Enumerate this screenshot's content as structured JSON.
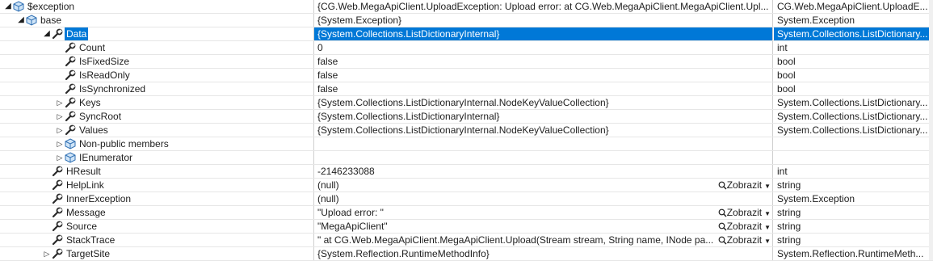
{
  "rows": [
    {
      "name": "$exception",
      "value": "{CG.Web.MegaApiClient.UploadException: Upload error:    at CG.Web.MegaApiClient.MegaApiClient.Upl...",
      "type": "CG.Web.MegaApiClient.UploadE...",
      "icon": "object-icon",
      "expander": "expanded",
      "level": 0
    },
    {
      "name": "base",
      "value": "{System.Exception}",
      "type": "System.Exception",
      "icon": "object-icon",
      "expander": "expanded",
      "level": 1
    },
    {
      "name": "Data",
      "value": "{System.Collections.ListDictionaryInternal}",
      "type": "System.Collections.ListDictionary...",
      "icon": "wrench-icon",
      "expander": "expanded",
      "level": 2,
      "selected": true
    },
    {
      "name": "Count",
      "value": "0",
      "type": "int",
      "icon": "wrench-icon",
      "expander": "none",
      "level": 3
    },
    {
      "name": "IsFixedSize",
      "value": "false",
      "type": "bool",
      "icon": "wrench-icon",
      "expander": "none",
      "level": 3
    },
    {
      "name": "IsReadOnly",
      "value": "false",
      "type": "bool",
      "icon": "wrench-icon",
      "expander": "none",
      "level": 3
    },
    {
      "name": "IsSynchronized",
      "value": "false",
      "type": "bool",
      "icon": "wrench-icon",
      "expander": "none",
      "level": 3
    },
    {
      "name": "Keys",
      "value": "{System.Collections.ListDictionaryInternal.NodeKeyValueCollection}",
      "type": "System.Collections.ListDictionary...",
      "icon": "wrench-icon",
      "expander": "collapsed",
      "level": 3
    },
    {
      "name": "SyncRoot",
      "value": "{System.Collections.ListDictionaryInternal}",
      "type": "System.Collections.ListDictionary...",
      "icon": "wrench-icon",
      "expander": "collapsed",
      "level": 3
    },
    {
      "name": "Values",
      "value": "{System.Collections.ListDictionaryInternal.NodeKeyValueCollection}",
      "type": "System.Collections.ListDictionary...",
      "icon": "wrench-icon",
      "expander": "collapsed",
      "level": 3
    },
    {
      "name": "Non-public members",
      "value": "",
      "type": "",
      "icon": "object-icon",
      "expander": "collapsed",
      "level": 3
    },
    {
      "name": "IEnumerator",
      "value": "",
      "type": "",
      "icon": "object-icon",
      "expander": "collapsed",
      "level": 3
    },
    {
      "name": "HResult",
      "value": "-2146233088",
      "type": "int",
      "icon": "wrench-icon",
      "expander": "none",
      "level": 2
    },
    {
      "name": "HelpLink",
      "value": "(null)",
      "type": "string",
      "icon": "wrench-icon",
      "expander": "none",
      "level": 2,
      "view": "Zobrazit"
    },
    {
      "name": "InnerException",
      "value": "(null)",
      "type": "System.Exception",
      "icon": "wrench-icon",
      "expander": "none",
      "level": 2
    },
    {
      "name": "Message",
      "value": "\"Upload error: \"",
      "type": "string",
      "icon": "wrench-icon",
      "expander": "none",
      "level": 2,
      "view": "Zobrazit"
    },
    {
      "name": "Source",
      "value": "\"MegaApiClient\"",
      "type": "string",
      "icon": "wrench-icon",
      "expander": "none",
      "level": 2,
      "view": "Zobrazit"
    },
    {
      "name": "StackTrace",
      "value": "\"   at CG.Web.MegaApiClient.MegaApiClient.Upload(Stream stream, String name, INode pa...",
      "type": "string",
      "icon": "wrench-icon",
      "expander": "none",
      "level": 2,
      "view": "Zobrazit"
    },
    {
      "name": "TargetSite",
      "value": "{System.Reflection.RuntimeMethodInfo}",
      "type": "System.Reflection.RuntimeMeth...",
      "icon": "wrench-icon",
      "expander": "collapsed",
      "level": 2
    }
  ]
}
